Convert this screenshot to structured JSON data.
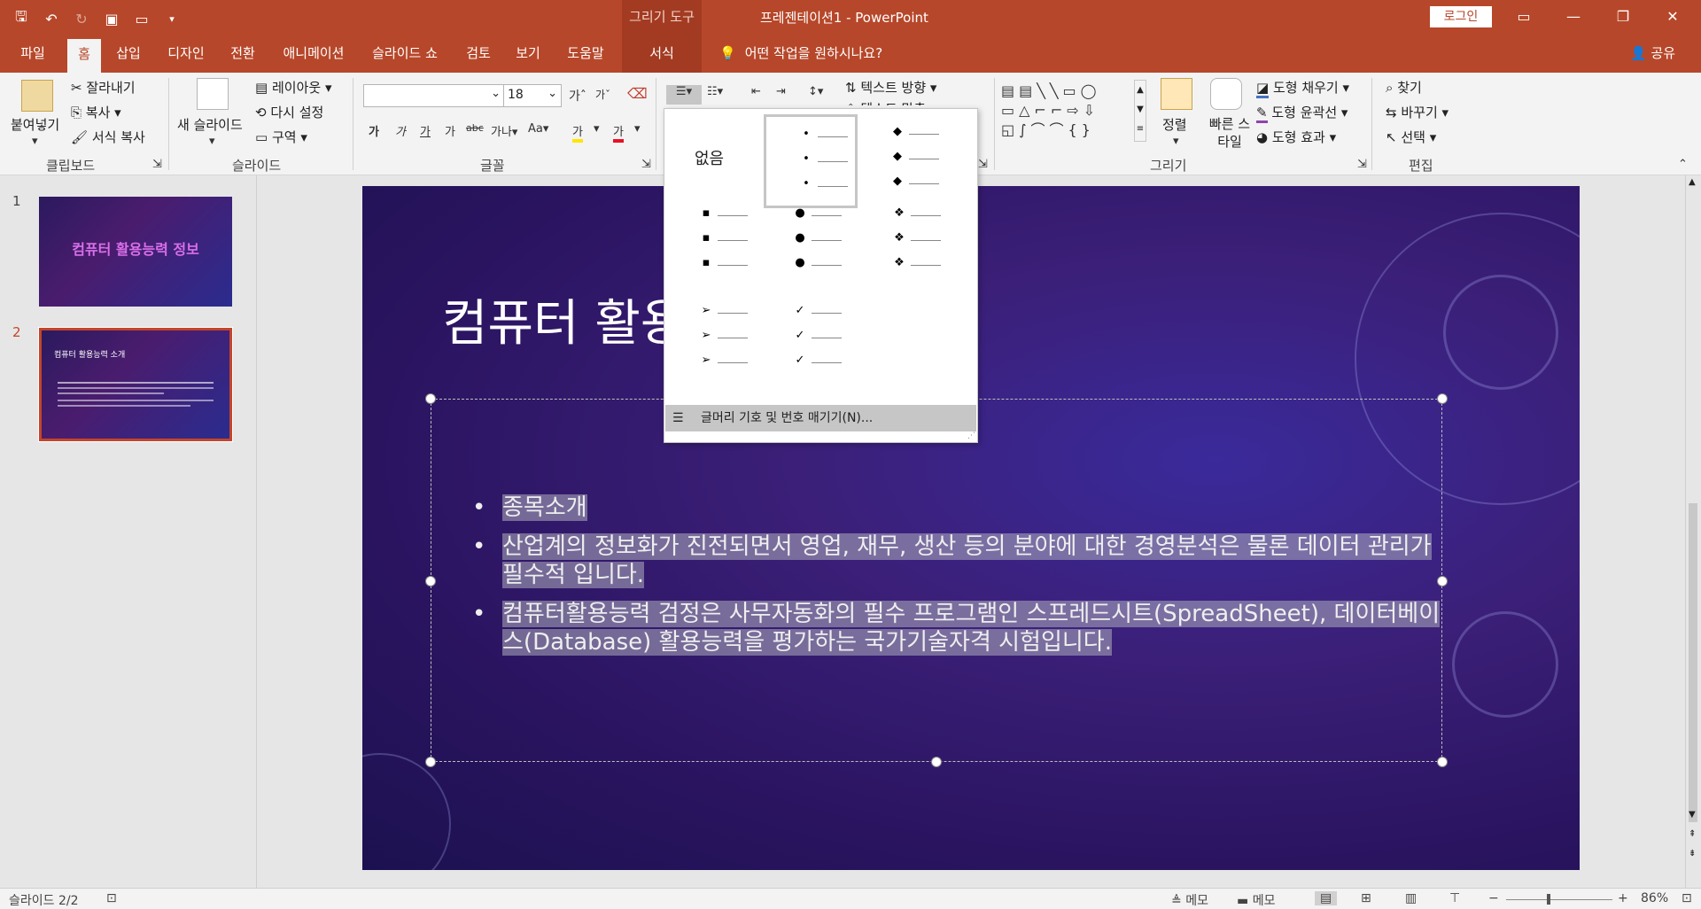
{
  "window": {
    "context_tab_header": "그리기 도구",
    "title": "프레젠테이션1  -  PowerPoint",
    "login_label": "로그인"
  },
  "tabs": [
    {
      "label": "파일"
    },
    {
      "label": "홈"
    },
    {
      "label": "삽입"
    },
    {
      "label": "디자인"
    },
    {
      "label": "전환"
    },
    {
      "label": "애니메이션"
    },
    {
      "label": "슬라이드 쇼"
    },
    {
      "label": "검토"
    },
    {
      "label": "보기"
    },
    {
      "label": "도움말"
    },
    {
      "label": "서식"
    }
  ],
  "tellme": "어떤 작업을 원하시나요?",
  "share": "공유",
  "ribbon": {
    "clipboard": {
      "paste": "붙여넣기",
      "cut": "잘라내기",
      "copy": "복사",
      "format_painter": "서식 복사",
      "group": "클립보드"
    },
    "slides": {
      "new_slide": "새 슬라이드",
      "layout": "레이아웃",
      "reset": "다시 설정",
      "section": "구역",
      "group": "슬라이드"
    },
    "font": {
      "size": "18",
      "group": "글꼴",
      "btn_b": "가",
      "btn_i": "가",
      "btn_u": "가",
      "btn_s": "abc",
      "btn_spacing": "가나",
      "btn_case": "Aa",
      "btn_highlight": "가",
      "btn_color": "가",
      "btn_grow": "가",
      "btn_shrink": "가"
    },
    "paragraph": {
      "text_direction": "텍스트 방향",
      "align_text": "텍스트 맞춤"
    },
    "drawing": {
      "arrange": "정렬",
      "quick_styles": "빠른 스타일",
      "fill": "도형 채우기",
      "outline": "도형 윤곽선",
      "effects": "도형 효과",
      "group": "그리기"
    },
    "editing": {
      "find": "찾기",
      "replace": "바꾸기",
      "select": "선택",
      "group": "편집"
    }
  },
  "slides_panel": [
    {
      "number": "1",
      "title": "컴퓨터 활용능력 정보"
    },
    {
      "number": "2",
      "title": "컴퓨터 활용능력 소개"
    }
  ],
  "slide": {
    "title": "컴퓨터 활용",
    "bullets": [
      "종목소개",
      "산업계의 정보화가 진전되면서 영업, 재무, 생산 등의 분야에 대한 경영분석은 물론 데이터 관리가 필수적 입니다.",
      "컴퓨터활용능력 검정은 사무자동화의 필수 프로그램인 스프레드시트(SpreadSheet), 데이터베이스(Database) 활용능력을 평가하는 국가기술자격 시험입니다."
    ]
  },
  "bullet_dropdown": {
    "none_label": "없음",
    "footer": "글머리 기호 및 번호 매기기(N)...",
    "styles": [
      {
        "symbol": "•",
        "selected": true
      },
      {
        "symbol": "◆",
        "selected": false
      },
      {
        "symbol": "▪",
        "selected": false
      },
      {
        "symbol": "●",
        "selected": false
      },
      {
        "symbol": "❖",
        "selected": false
      },
      {
        "symbol": "➢",
        "selected": false
      },
      {
        "symbol": "✓",
        "selected": false
      }
    ]
  },
  "status": {
    "slide_info": "슬라이드 2/2",
    "notes": "메모",
    "comments": "메모",
    "zoom": "86%"
  },
  "colors": {
    "accent": "#b7472a",
    "ribbon": "#f3f3f3"
  }
}
